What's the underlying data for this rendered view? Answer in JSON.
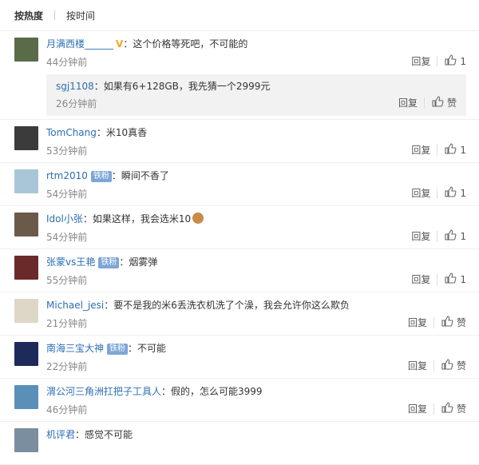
{
  "tabs": {
    "hot": "按热度",
    "time": "按时间"
  },
  "ui": {
    "reply": "回复",
    "like": "赞",
    "fan_badge": "铁粉"
  },
  "comments": [
    {
      "name": "月满西楼______",
      "badge": "V",
      "text": "这个价格等死吧，不可能的",
      "time": "44分钟前",
      "likes": "1",
      "reply": {
        "name": "sgj1108",
        "text": "如果有6+128GB，我先猜一个2999元",
        "time": "26分钟前"
      }
    },
    {
      "name": "TomChang",
      "text": "米10真香",
      "time": "53分钟前",
      "likes": "1"
    },
    {
      "name": "rtm2010",
      "badge": "铁粉",
      "text": "瞬间不香了",
      "time": "54分钟前",
      "likes": "1"
    },
    {
      "name": "Idol小张",
      "text": "如果这样，我会选米10",
      "time": "54分钟前",
      "likes": "1"
    },
    {
      "name": "张蒙vs王艳",
      "badge": "铁粉",
      "text": "烟雾弹",
      "time": "55分钟前",
      "likes": "1"
    },
    {
      "name": "Michael_jesi",
      "text": "要不是我的米6丢洗衣机洗了个澡，我会允许你这么欺负",
      "time": "21分钟前",
      "likes": ""
    },
    {
      "name": "南海三宝大神",
      "badge": "铁粉",
      "text": "不可能",
      "time": "22分钟前",
      "likes": ""
    },
    {
      "name": "渭公河三角洲扛把子工具人",
      "text": "假的，怎么可能3999",
      "time": "46分钟前",
      "likes": ""
    },
    {
      "name": "机评君",
      "text": "感觉不可能",
      "time": "",
      "likes": ""
    }
  ],
  "colors": {
    "name": "#2b6eb3",
    "badge": "#7ea6d6",
    "vip": "#f5a623"
  }
}
